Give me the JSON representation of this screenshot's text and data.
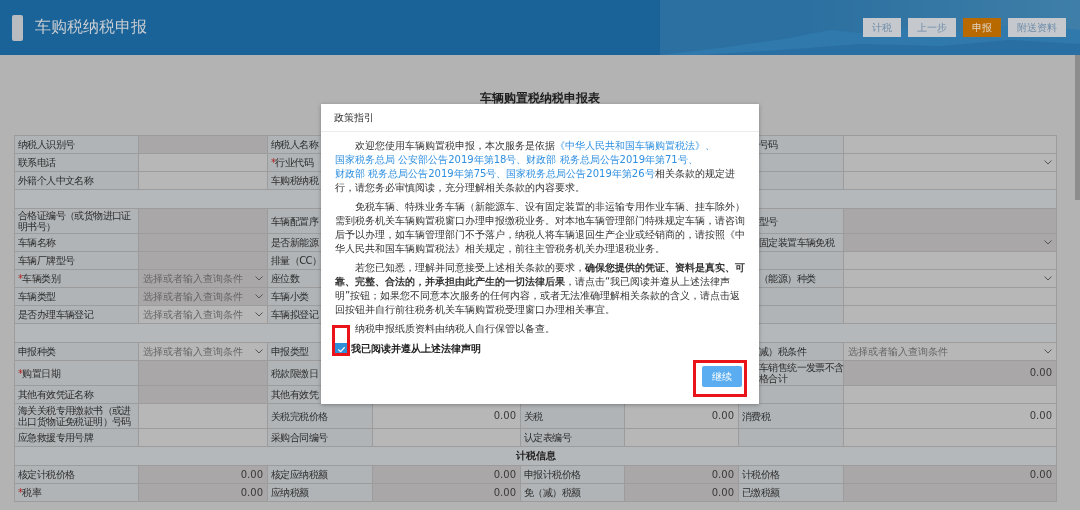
{
  "header": {
    "title": "车购税纳税申报",
    "buttons": [
      {
        "label": "计税",
        "primary": false
      },
      {
        "label": "上一步",
        "primary": false
      },
      {
        "label": "申报",
        "primary": true
      },
      {
        "label": "附送资料",
        "primary": false
      }
    ]
  },
  "form": {
    "title": "车辆购置税纳税申报表",
    "rows": [
      {
        "kind": "fields",
        "cells": [
          {
            "kind": "label",
            "text": "纳税人识别号"
          },
          {
            "kind": "value",
            "disabled": true
          },
          {
            "kind": "label",
            "text": "纳税人名称"
          },
          {
            "kind": "value"
          },
          {
            "kind": "label"
          },
          {
            "kind": "value"
          },
          {
            "kind": "label",
            "text": "号码"
          },
          {
            "kind": "value",
            "disabled": false
          }
        ]
      },
      {
        "kind": "fields",
        "cells": [
          {
            "kind": "label",
            "text": "联系电话"
          },
          {
            "kind": "value",
            "disabled": false
          },
          {
            "kind": "label",
            "text": "行业代码",
            "marker": "*"
          },
          {
            "kind": "value"
          },
          {
            "kind": "label"
          },
          {
            "kind": "value"
          },
          {
            "kind": "label"
          },
          {
            "kind": "value",
            "disabled": false,
            "select": true
          }
        ]
      },
      {
        "kind": "fields",
        "cells": [
          {
            "kind": "label",
            "text": "外籍个人中文名称"
          },
          {
            "kind": "value",
            "disabled": false
          },
          {
            "kind": "label",
            "text": "车购税纳税"
          },
          {
            "kind": "value"
          },
          {
            "kind": "label"
          },
          {
            "kind": "value"
          },
          {
            "kind": "label"
          },
          {
            "kind": "value",
            "disabled": false
          }
        ]
      },
      {
        "kind": "section"
      },
      {
        "kind": "fields",
        "cells": [
          {
            "kind": "label",
            "text": "合格证编号（或货物进口证明书号）"
          },
          {
            "kind": "value",
            "disabled": true
          },
          {
            "kind": "label",
            "text": "车辆配置序"
          },
          {
            "kind": "value"
          },
          {
            "kind": "label"
          },
          {
            "kind": "value"
          },
          {
            "kind": "label",
            "text": "型号"
          },
          {
            "kind": "value",
            "disabled": true
          }
        ]
      },
      {
        "kind": "fields",
        "cells": [
          {
            "kind": "label",
            "text": "车辆名称"
          },
          {
            "kind": "value",
            "disabled": true
          },
          {
            "kind": "label",
            "text": "是否新能源"
          },
          {
            "kind": "value"
          },
          {
            "kind": "label"
          },
          {
            "kind": "value"
          },
          {
            "kind": "label",
            "text": "固定装置车辆免税"
          },
          {
            "kind": "value",
            "disabled": true,
            "select": true
          }
        ]
      },
      {
        "kind": "fields",
        "cells": [
          {
            "kind": "label",
            "text": "车辆厂牌型号"
          },
          {
            "kind": "value",
            "disabled": true
          },
          {
            "kind": "label",
            "text": "排量（CC）"
          },
          {
            "kind": "value"
          },
          {
            "kind": "label"
          },
          {
            "kind": "value"
          },
          {
            "kind": "label"
          },
          {
            "kind": "value",
            "disabled": false
          }
        ]
      },
      {
        "kind": "fields",
        "cells": [
          {
            "kind": "label",
            "text": "车辆类别",
            "marker": "*"
          },
          {
            "kind": "value",
            "disabled": true,
            "select": true,
            "placeholder": "选择或者输入查询条件"
          },
          {
            "kind": "label",
            "text": "座位数"
          },
          {
            "kind": "value"
          },
          {
            "kind": "label"
          },
          {
            "kind": "value"
          },
          {
            "kind": "label",
            "text": "（能源）种类"
          },
          {
            "kind": "value",
            "disabled": false,
            "select": true
          }
        ]
      },
      {
        "kind": "fields",
        "cells": [
          {
            "kind": "label",
            "text": "车辆类型"
          },
          {
            "kind": "value",
            "disabled": true,
            "select": true,
            "placeholder": "选择或者输入查询条件"
          },
          {
            "kind": "label",
            "text": "车辆小类"
          },
          {
            "kind": "value"
          },
          {
            "kind": "label"
          },
          {
            "kind": "value"
          },
          {
            "kind": "label"
          },
          {
            "kind": "value",
            "disabled": false
          }
        ]
      },
      {
        "kind": "fields",
        "cells": [
          {
            "kind": "label",
            "text": "是否办理车辆登记"
          },
          {
            "kind": "value",
            "disabled": false,
            "select": true,
            "placeholder": "选择或者输入查询条件"
          },
          {
            "kind": "label",
            "text": "车辆拟登记"
          },
          {
            "kind": "value"
          },
          {
            "kind": "label"
          },
          {
            "kind": "value"
          },
          {
            "kind": "label"
          },
          {
            "kind": "value",
            "disabled": false
          }
        ]
      },
      {
        "kind": "section"
      },
      {
        "kind": "fields",
        "cells": [
          {
            "kind": "label",
            "text": "申报种类"
          },
          {
            "kind": "value",
            "disabled": false,
            "select": true,
            "placeholder": "选择或者输入查询条件"
          },
          {
            "kind": "label",
            "text": "申报类型"
          },
          {
            "kind": "value"
          },
          {
            "kind": "label"
          },
          {
            "kind": "value"
          },
          {
            "kind": "label",
            "text": "减）税条件"
          },
          {
            "kind": "value",
            "disabled": false,
            "select": true,
            "placeholder": "选择或者输入查询条件"
          }
        ]
      },
      {
        "kind": "fields",
        "cells": [
          {
            "kind": "label",
            "text": "购置日期",
            "marker": "*"
          },
          {
            "kind": "value",
            "disabled": true
          },
          {
            "kind": "label",
            "text": "税款限缴日"
          },
          {
            "kind": "value"
          },
          {
            "kind": "label"
          },
          {
            "kind": "value"
          },
          {
            "kind": "label",
            "lines": [
              "车销售统一发票不含",
              "格合计"
            ]
          },
          {
            "kind": "value",
            "disabled": true,
            "text": "0.00"
          }
        ]
      },
      {
        "kind": "fields",
        "cells": [
          {
            "kind": "label",
            "text": "其他有效凭证名称"
          },
          {
            "kind": "value",
            "disabled": true
          },
          {
            "kind": "label",
            "text": "其他有效凭"
          },
          {
            "kind": "value"
          },
          {
            "kind": "label"
          },
          {
            "kind": "value"
          },
          {
            "kind": "label"
          },
          {
            "kind": "value",
            "disabled": false
          }
        ]
      },
      {
        "kind": "fields",
        "cells": [
          {
            "kind": "label",
            "text": "海关关税专用缴款书（或进出口货物证免税证明）号码"
          },
          {
            "kind": "value",
            "disabled": false
          },
          {
            "kind": "label",
            "text": "关税完税价格"
          },
          {
            "kind": "value",
            "disabled": false,
            "text": "0.00"
          },
          {
            "kind": "label",
            "text": "关税"
          },
          {
            "kind": "value",
            "disabled": false,
            "text": "0.00"
          },
          {
            "kind": "label",
            "text": "消费税"
          },
          {
            "kind": "value",
            "disabled": false,
            "text": "0.00"
          }
        ]
      },
      {
        "kind": "fields",
        "cells": [
          {
            "kind": "label",
            "text": "应急救援专用号牌"
          },
          {
            "kind": "value",
            "disabled": false
          },
          {
            "kind": "label",
            "text": "采购合同编号"
          },
          {
            "kind": "value",
            "disabled": false
          },
          {
            "kind": "label",
            "text": "认定表编号"
          },
          {
            "kind": "value",
            "disabled": false
          },
          {
            "kind": "label"
          },
          {
            "kind": "value",
            "disabled": false
          }
        ]
      },
      {
        "kind": "section",
        "label": "计税信息"
      },
      {
        "kind": "fields",
        "cells": [
          {
            "kind": "label",
            "text": "核定计税价格"
          },
          {
            "kind": "value",
            "disabled": true,
            "text": "0.00"
          },
          {
            "kind": "label",
            "text": "核定应纳税额"
          },
          {
            "kind": "value",
            "disabled": true,
            "text": "0.00"
          },
          {
            "kind": "label",
            "text": "申报计税价格"
          },
          {
            "kind": "value",
            "disabled": true,
            "text": "0.00"
          },
          {
            "kind": "label",
            "text": "计税价格"
          },
          {
            "kind": "value",
            "disabled": true,
            "text": "0.00"
          }
        ]
      },
      {
        "kind": "fields",
        "cells": [
          {
            "kind": "label",
            "text": "税率",
            "marker": "*"
          },
          {
            "kind": "value",
            "disabled": true,
            "text": "0.00"
          },
          {
            "kind": "label",
            "text": "应纳税额"
          },
          {
            "kind": "value",
            "disabled": true,
            "text": "0.00"
          },
          {
            "kind": "label",
            "text": "免（减）税额"
          },
          {
            "kind": "value",
            "disabled": true,
            "text": "0.00"
          },
          {
            "kind": "label",
            "text": "已缴税额"
          },
          {
            "kind": "value",
            "disabled": true
          }
        ]
      }
    ]
  },
  "dialog": {
    "title": "政策指引",
    "paragraphs": [
      {
        "segments": [
          {
            "text": "欢迎您使用车辆购置税申报，本次服务是依据",
            "link": false
          },
          {
            "text": "《中华人民共和国车辆购置税法》、",
            "link": true
          },
          {
            "text": "国家税务总局 公安部公告2019年第18号、",
            "link": true
          },
          {
            "text": "财政部 税务总局公告2019年第71号、",
            "link": true
          },
          {
            "text": "财政部 税务总局公告2019年第75号、",
            "link": true
          },
          {
            "text": "国家税务总局公告2019年第26号",
            "link": true
          },
          {
            "text": "相关条款的规定进行，请您务必审慎阅读，充分理解相关条款的内容要求。",
            "link": false
          }
        ]
      },
      {
        "segments": [
          {
            "text": "免税车辆、特殊业务车辆（新能源车、设有固定装置的非运输专用作业车辆、挂车除外）需到税务机关车辆购置税窗口办理申报缴税业务。对本地车辆管理部门特殊规定车辆，请咨询后予以办理，如车辆管理部门不予落户，纳税人将车辆退回生产企业或经销商的，请按照《中华人民共和国车辆购置税法》相关规定，前往主管税务机关办理退税业务。",
            "link": false
          }
        ]
      },
      {
        "segments": [
          {
            "text": "若您已知悉，理解并同意接受上述相关条款的要求，**确保您提供的凭证、资料是真实、可靠、完整、合法的，并承担由此产生的一切法律后果**，请点击“我已阅读并遵从上述法律声明”按钮；如果您不同意本次服务的任何内容，或者无法准确理解相关条款的含义，请点击返回按钮并自行前往税务机关车辆购置税受理窗口办理相关事宜。",
            "link": false
          }
        ]
      },
      {
        "segments": [
          {
            "text": "纳税申报纸质资料由纳税人自行保管以备查。",
            "link": false
          }
        ]
      }
    ],
    "agree": {
      "label": "我已阅读并遵从上述法律声明",
      "checked": true
    },
    "continue_button": "继续"
  }
}
